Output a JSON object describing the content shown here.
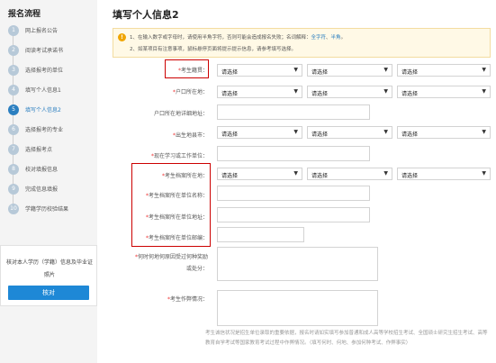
{
  "sidebar": {
    "title": "报名流程",
    "steps": [
      {
        "num": "1",
        "label": "网上报名公告"
      },
      {
        "num": "2",
        "label": "阅读考试承诺书"
      },
      {
        "num": "3",
        "label": "选择报考的单位"
      },
      {
        "num": "4",
        "label": "填写个人信息1"
      },
      {
        "num": "5",
        "label": "填写个人信息2"
      },
      {
        "num": "6",
        "label": "选择报考的专业"
      },
      {
        "num": "7",
        "label": "选择报考点"
      },
      {
        "num": "8",
        "label": "校对填报信息"
      },
      {
        "num": "9",
        "label": "完成信息填报"
      },
      {
        "num": "10",
        "label": "学籍学历校验结果"
      }
    ],
    "verify_text": "核对本人学历（学籍）信息及毕业证照片",
    "verify_button": "核对"
  },
  "main": {
    "title": "填写个人信息2",
    "notice": {
      "line1_prefix": "1、在输入数字或字母时，请使用半角字符，否则可能会造成报名失败；名词解释：",
      "line1_hl1": "全字符",
      "line1_mid": "、",
      "line1_hl2": "半角",
      "line1_end": "。",
      "line2": "2、如某项目有注意事项，鼠标悬停页面将提示提示信息，请参考填写选择。"
    },
    "select_placeholder": "请选择",
    "fields": {
      "birthplace": {
        "req": "*",
        "label": "考生籍贯："
      },
      "hukou": {
        "req": "*",
        "label": "户口所在地："
      },
      "hukou_addr": {
        "label": "户口所在地详细地址："
      },
      "origin": {
        "req": "*",
        "label": "出生地县市："
      },
      "work_unit": {
        "req": "*",
        "label": "现在学习或工作单位："
      },
      "archive_loc": {
        "req": "*",
        "label": "考生档案所在地："
      },
      "archive_unit": {
        "req": "*",
        "label": "考生档案所在单位名称："
      },
      "archive_addr": {
        "req": "*",
        "label": "考生档案所在单位地址："
      },
      "archive_zip": {
        "req": "*",
        "label": "考生档案所在单位邮编："
      },
      "rewards": {
        "req": "*",
        "label1": "何时何地何原因受过何种奖励",
        "label2": "或处分："
      },
      "cheating": {
        "req": "*",
        "label": "考生作弊情况："
      }
    },
    "note": "考生诚信状况是招生单位录取的重要依据，报名时请如实填写参加普通和成人高等学校招生考试、全国硕士研究生招生考试、高等教育自学考试等国家教育考试过程中作弊情况。（填写何时、何地、参加何种考试、作弊事实）"
  },
  "colors": {
    "accent": "#2b7fc0",
    "button": "#1e88d6",
    "highlight_box": "#cc0000",
    "notice_bg": "#fff9e6"
  }
}
